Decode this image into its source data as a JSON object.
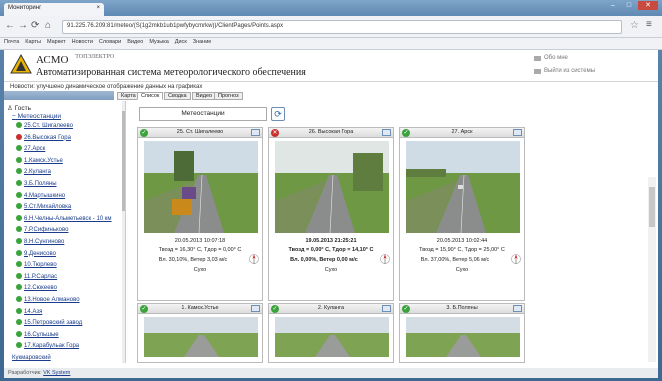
{
  "browser": {
    "tab_title": "Мониторинг",
    "url": "91.225.76.209:81/meteo/(S(1g2mkb1ub1pwfybycmrkw))/ClientPages/Points.aspx",
    "bookmarks": [
      "Почта",
      "Карты",
      "Маркет",
      "Новости",
      "Словари",
      "Видео",
      "Музыка",
      "Диск",
      "Знание"
    ]
  },
  "header": {
    "logo_text": "АСМО",
    "logo_small": "ТОПЭЛЕКТРО",
    "subtitle": "Автоматизированная система метеорологического обеспечения",
    "right_items": [
      "Обо мне",
      "Выйти из системы"
    ]
  },
  "newsbar": "Новости: улучшено динамическое отображение данных на графиках",
  "tabs": [
    "Карта",
    "Список",
    "Сводка",
    "Видео",
    "Прогноз"
  ],
  "sidebar": {
    "root": "Гость",
    "branch": "Метеостанции",
    "items": [
      {
        "label": "25.Ст. Шигалеево",
        "status": "ok"
      },
      {
        "label": "26.Высокая Гора",
        "status": "err"
      },
      {
        "label": "27.Арск",
        "status": "ok"
      },
      {
        "label": "1.Камск.Устье",
        "status": "ok"
      },
      {
        "label": "2.Куланга",
        "status": "ok"
      },
      {
        "label": "3.Б.Поляны",
        "status": "ok"
      },
      {
        "label": "4.Мартышкино",
        "status": "ok"
      },
      {
        "label": "5.Ст.Михайловка",
        "status": "ok"
      },
      {
        "label": "6.Н.Челны-Альметьевск - 10 км",
        "status": "ok"
      },
      {
        "label": "7.Р.Сифиньково",
        "status": "ok"
      },
      {
        "label": "8.Н.Сунгиново",
        "status": "ok"
      },
      {
        "label": "9.Денисово",
        "status": "ok"
      },
      {
        "label": "10.Тюрлево",
        "status": "ok"
      },
      {
        "label": "11.Р.Сарлас",
        "status": "ok"
      },
      {
        "label": "12.Сюкеево",
        "status": "ok"
      },
      {
        "label": "13.Новое Алманово",
        "status": "ok"
      },
      {
        "label": "14.Азя",
        "status": "ok"
      },
      {
        "label": "15.Петровский завод",
        "status": "ok"
      },
      {
        "label": "16.Сульшые",
        "status": "ok"
      },
      {
        "label": "17.Карабульак Гора",
        "status": "ok"
      },
      {
        "label": "Кукмаровский",
        "status": "tree"
      }
    ]
  },
  "main": {
    "selector_label": "Метеостанции",
    "refresh_icon": "refresh-icon"
  },
  "cards": [
    {
      "title": "25. Ст. Шигалеево",
      "status": "ok",
      "timestamp": "20.05.2013 10:07:18",
      "temps": "Твозд = 16,30° С, Тдор = 0,00° С",
      "wind": "Вл. 30,10%, Ветер 3,03 м/с",
      "weather": "Сухо"
    },
    {
      "title": "26. Высокая Гора",
      "status": "err",
      "timestamp": "19.05.2013 21:25:21",
      "temps": "Твозд = 0,00° С, Тдор = 14,10° С",
      "wind": "Вл. 0,00%, Ветер 0,00 м/с",
      "weather": "Сухо"
    },
    {
      "title": "27. Арск",
      "status": "ok",
      "timestamp": "20.05.2013 10:02:44",
      "temps": "Твозд = 15,90° С, Тдор = 25,00° С",
      "wind": "Вл. 37,00%, Ветер 5,06 м/с",
      "weather": "Сухо"
    },
    {
      "title": "1. Камск.Устье",
      "status": "ok"
    },
    {
      "title": "2. Куланга",
      "status": "ok"
    },
    {
      "title": "3. Б.Поляны",
      "status": "ok"
    }
  ],
  "footer": {
    "label": "Разработчик:",
    "link": "VK System"
  }
}
